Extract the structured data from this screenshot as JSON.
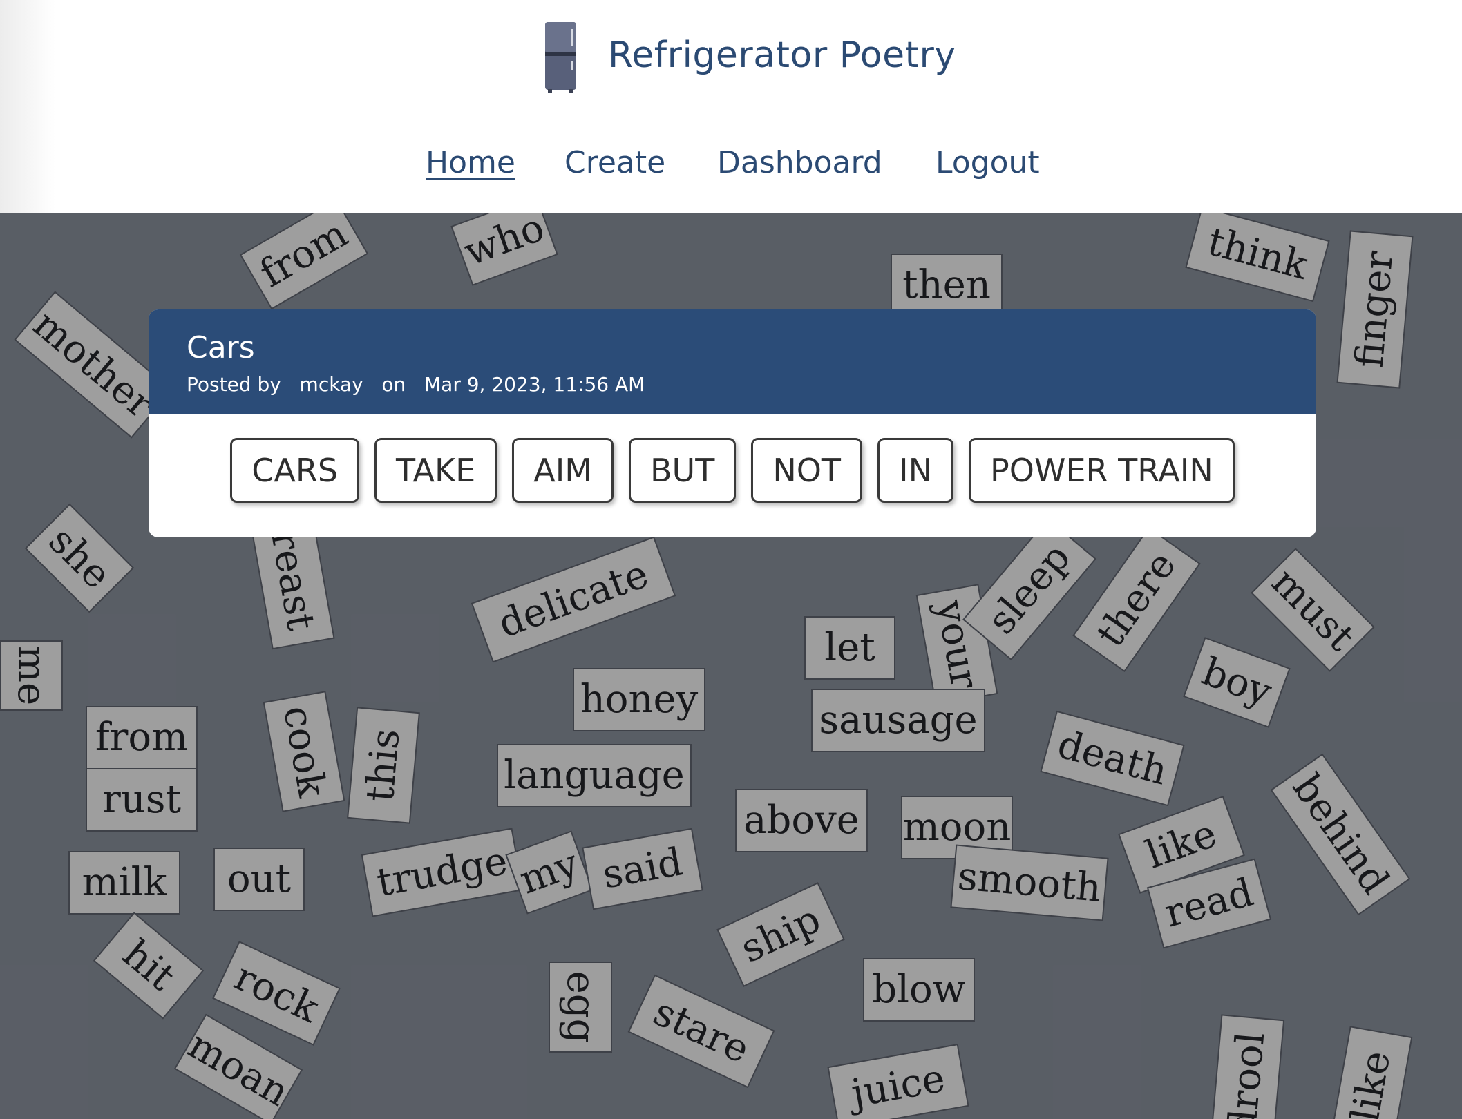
{
  "header": {
    "logo_icon": "refrigerator-icon",
    "title": "Refrigerator Poetry"
  },
  "nav": {
    "items": [
      {
        "label": "Home",
        "active": true
      },
      {
        "label": "Create",
        "active": false
      },
      {
        "label": "Dashboard",
        "active": false
      },
      {
        "label": "Logout",
        "active": false
      }
    ]
  },
  "background": {
    "magnets": [
      "from",
      "who",
      "then",
      "think",
      "finger",
      "mother",
      "she",
      "breast",
      "delicate",
      "let",
      "your",
      "sleep",
      "there",
      "must",
      "me",
      "honey",
      "sausage",
      "boy",
      "from",
      "cook",
      "this",
      "language",
      "death",
      "rust",
      "above",
      "moon",
      "like",
      "behind",
      "milk",
      "out",
      "trudge",
      "my",
      "said",
      "smooth",
      "read",
      "ship",
      "hit",
      "rock",
      "egg",
      "blow",
      "stare",
      "moan",
      "juice",
      "drool",
      "like"
    ]
  },
  "post": {
    "title": "Cars",
    "meta": {
      "prefix": "Posted by",
      "author": "mckay",
      "on": "on",
      "date": "Mar 9, 2023, 11:56 AM"
    },
    "words": [
      "CARS",
      "TAKE",
      "AIM",
      "BUT",
      "NOT",
      "IN",
      "POWER TRAIN"
    ]
  },
  "colors": {
    "brand": "#2b4a73",
    "card_header": "#2b4c78",
    "background_overlay": "#7f848b"
  }
}
